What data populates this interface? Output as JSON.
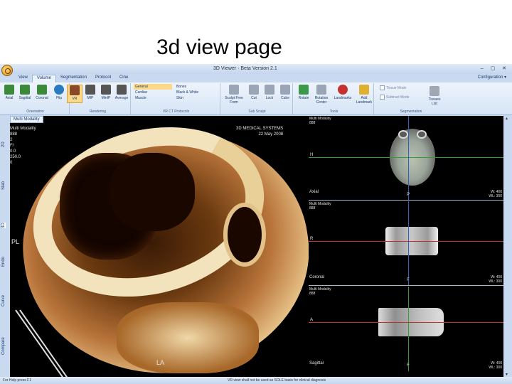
{
  "slide": {
    "title": "3d view page"
  },
  "app": {
    "window_title": "3D Viewer · Beta Version 2.1",
    "window_controls": "–  ▢  ✕",
    "tabs": [
      {
        "label": "View"
      },
      {
        "label": "Volume"
      },
      {
        "label": "Segmentation"
      },
      {
        "label": "Protocol"
      },
      {
        "label": "Cine"
      }
    ],
    "active_tab": "Volume",
    "configuration_label": "Configuration"
  },
  "ribbon": {
    "orientation": {
      "buttons": [
        {
          "label": "Axial"
        },
        {
          "label": "Sagittal"
        },
        {
          "label": "Coronal"
        },
        {
          "label": "Flip"
        }
      ],
      "label": "Orientation"
    },
    "rendering": {
      "buttons": [
        {
          "label": "VR"
        },
        {
          "label": "MIP"
        },
        {
          "label": "MinIP"
        },
        {
          "label": "Average"
        }
      ],
      "label": "Rendering",
      "selected": "VR"
    },
    "vr_protocols": {
      "col1": [
        "General",
        "Cardiac",
        "Muscle"
      ],
      "col2": [
        "Bones",
        "Black & White",
        "Skin"
      ],
      "selected": "General",
      "label": "VR CT Protocols"
    },
    "sculpt": {
      "buttons": [
        {
          "label": "Sculpt Free Form"
        },
        {
          "label": "Cut"
        },
        {
          "label": "Lock"
        },
        {
          "label": "Cube"
        }
      ],
      "label": "Sub Sculpt"
    },
    "tools": {
      "buttons": [
        {
          "label": "Rotate"
        },
        {
          "label": "Rotation Center"
        },
        {
          "label": "Landmarks"
        },
        {
          "label": "Add Landmark"
        }
      ],
      "label": "Tools"
    },
    "segmentation": {
      "checkboxes": [
        {
          "label": "Tissue Mode"
        },
        {
          "label": "Subtract Mode"
        }
      ],
      "tissues_label": "Tissues List",
      "label": "Segmentation"
    }
  },
  "viewer": {
    "left_tabs": [
      "2D",
      "Slab",
      "3D",
      "Endo",
      "Curve",
      "Compare"
    ],
    "active_left_tab": "3D",
    "doc_tab": "Multi Modality",
    "vr": {
      "info_lines": [
        "Multi Modality",
        "888",
        "2",
        "F/",
        "0.0",
        "250.0",
        "0"
      ],
      "brand_lines": [
        "3D MEDICAL SYSTEMS",
        "22 May 2008"
      ],
      "orient_pl": "PL",
      "orient_la": "LA"
    },
    "panes": [
      {
        "info_lines": [
          "Multi Modality",
          "888"
        ],
        "top_label": "",
        "left_label": "H",
        "bottom_label": "P",
        "name": "Axial",
        "wl_lines": [
          "W: 400",
          "WL: 300"
        ]
      },
      {
        "info_lines": [
          "Multi Modality",
          "888"
        ],
        "top_label": "",
        "left_label": "R",
        "bottom_label": "F",
        "name": "Coronal",
        "wl_lines": [
          "W: 400",
          "WL: 300"
        ]
      },
      {
        "info_lines": [
          "Multi Modality",
          "888"
        ],
        "top_label": "",
        "left_label": "A",
        "bottom_label": "F",
        "name": "Sagittal",
        "wl_lines": [
          "W: 400",
          "WL: 300"
        ]
      }
    ]
  },
  "statusbar": {
    "left": "For Help press F1",
    "center": "VR view shall not be used as SOLE basis for clinical diagnosis"
  },
  "colors": {
    "ribbon_bg": "#d6e4f5",
    "accent_selected": "#fbd88a",
    "axial_line": "#c03030",
    "coronal_line": "#30a030",
    "sagittal_line": "#3060c0"
  }
}
